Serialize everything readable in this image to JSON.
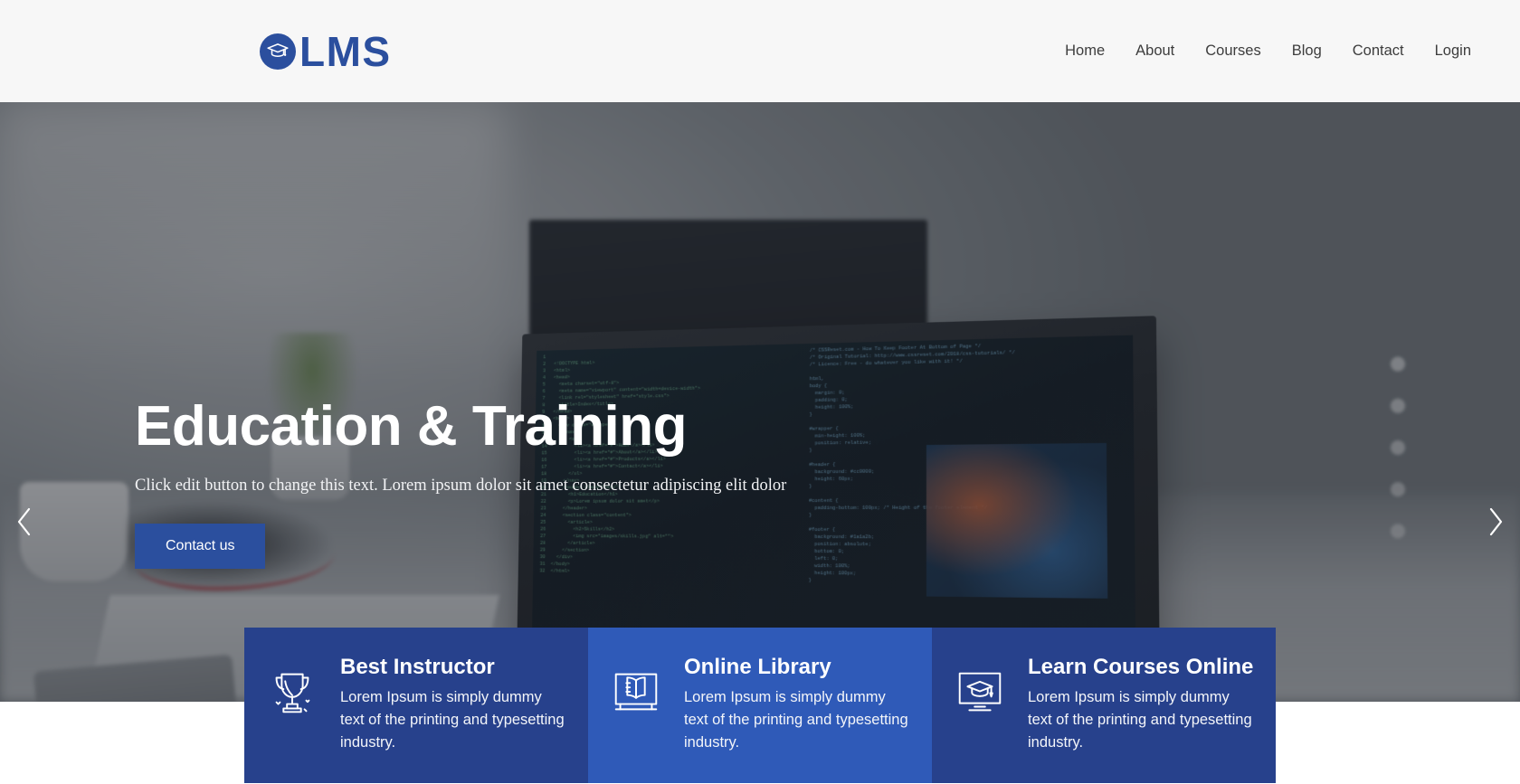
{
  "header": {
    "brand": {
      "text": "LMS",
      "icon": "graduation-cap-icon",
      "color": "#2b4f9e"
    },
    "nav": [
      {
        "label": "Home"
      },
      {
        "label": "About"
      },
      {
        "label": "Courses"
      },
      {
        "label": "Blog"
      },
      {
        "label": "Contact"
      },
      {
        "label": "Login"
      }
    ],
    "background": "#f7f7f7"
  },
  "hero": {
    "title": "Education & Training",
    "subtitle": "Click edit button to change this text. Lorem ipsum dolor sit amet consectetur adipiscing elit dolor",
    "button_label": "Contact us",
    "button_color": "#2b4f9e",
    "prev_icon": "chevron-left-icon",
    "next_icon": "chevron-right-icon"
  },
  "features": [
    {
      "icon": "trophy-icon",
      "title": "Best Instructor",
      "text": "Lorem Ipsum is simply dummy text of the printing and typesetting industry.",
      "background": "#27418c"
    },
    {
      "icon": "open-book-icon",
      "title": "Online Library",
      "text": "Lorem Ipsum is simply dummy text of the printing and typesetting industry.",
      "background": "#2f5ab8"
    },
    {
      "icon": "monitor-graduation-cap-icon",
      "title": "Learn Courses Online",
      "text": "Lorem Ipsum is simply dummy text of the printing and typesetting industry.",
      "background": "#27418c"
    }
  ],
  "decor": {
    "code_left": "1\n2   <!DOCTYPE html>\n3   <html>\n4   <head>\n5     <meta charset=\"utf-8\">\n6     <meta name=\"viewport\" content=\"width=device-width\">\n7     <link rel=\"stylesheet\" href=\"style.css\">\n8     <title>Index</title>\n9   </head>\n10  <body>\n11    <div class=\"wrapper\">\n12      <nav>\n13        <ul>\n14          <li><a href=\"#\">Home</a></li>\n15          <li><a href=\"#\">About</a></li>\n16          <li><a href=\"#\">Products</a></li>\n17          <li><a href=\"#\">Contact</a></li>\n18        </ul>\n19      </nav>\n20      <header class=\"hero\">\n21        <h1>Education</h1>\n22        <p>Lorem ipsum dolor sit amet</p>\n23      </header>\n24      <section class=\"content\">\n25        <article>\n26          <h2>Skills</h2>\n27          <img src=\"images/skills.jpg\" alt=\"\">\n28        </article>\n29      </section>\n30    </div>\n31  </body>\n32  </html>",
    "code_right": "/* CSSReset.com - How To Keep Footer At Bottom of Page */\n/* Original Tutorial: http://www.cssreset.com/2018/css-tutorials/ */\n/* Licence: Free - do whatever you like with it! */\n\nhtml,\nbody {\n  margin: 0;\n  padding: 0;\n  height: 100%;\n}\n\n#wrapper {\n  min-height: 100%;\n  position: relative;\n}\n\n#header {\n  background: #cc0000;\n  height: 60px;\n}\n\n#content {\n  padding-bottom: 100px; /* Height of the footer element */\n}\n\n#footer {\n  background: #1a1a2b;\n  position: absolute;\n  bottom: 0;\n  left: 0;\n  width: 100%;\n  height: 100px;\n}"
  }
}
